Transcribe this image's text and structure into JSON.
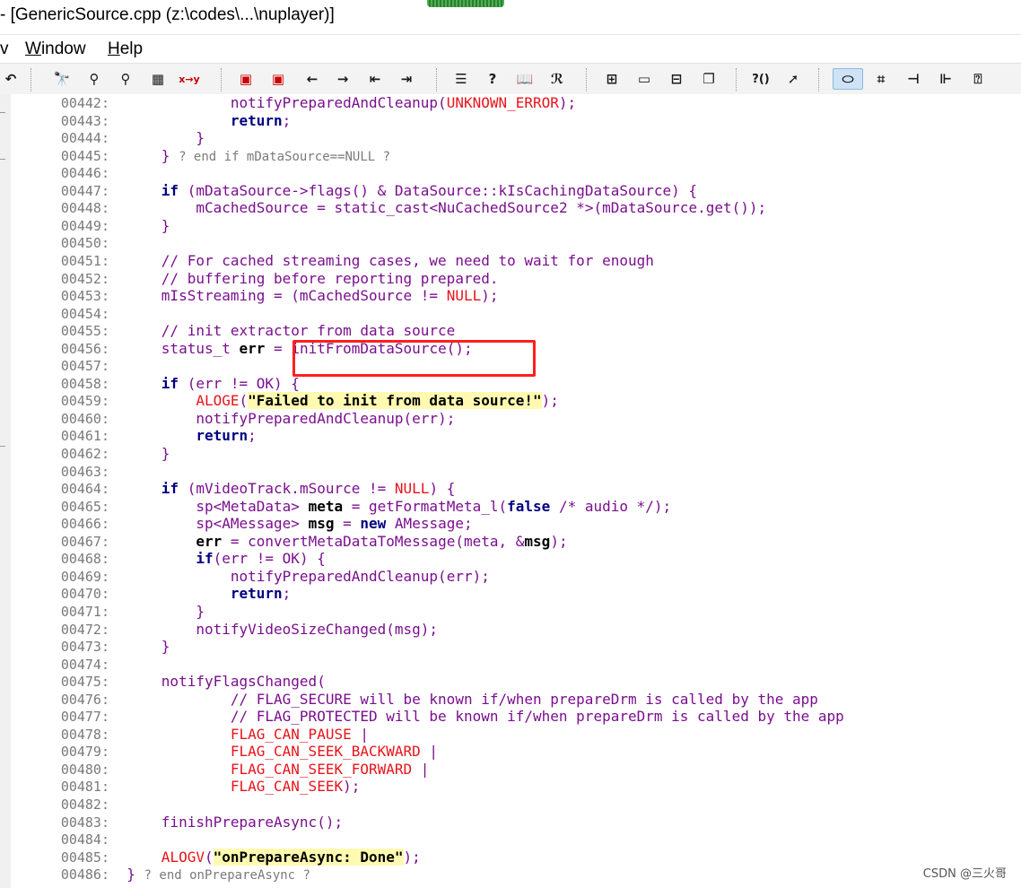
{
  "window": {
    "title": "- [GenericSource.cpp (z:\\codes\\...\\nuplayer)]"
  },
  "menu": {
    "partial_view": "v",
    "window_label": "Window",
    "window_underline": "W",
    "window_rest": "indow",
    "help_label": "Help",
    "help_underline": "H",
    "help_rest": "elp"
  },
  "toolbar": {
    "icons": [
      "undo-icon",
      "find-icon",
      "find-next-icon",
      "find-prev-icon",
      "find-in-files-icon",
      "replace-icon",
      "bookmark-prev-icon",
      "bookmark-next-icon",
      "back-icon",
      "forward-icon",
      "indent-left-icon",
      "indent-right-icon",
      "symbol-window-icon",
      "project-icon",
      "book-icon",
      "relation-icon",
      "tile-icon",
      "window-icon",
      "window-split-icon",
      "cascade-icon",
      "context-help-icon",
      "pointer-help-icon",
      "highlight-icon",
      "layout-icon",
      "tree-icon",
      "branch-icon",
      "info-icon"
    ],
    "xy_label": "x→y",
    "help_label": "?()"
  },
  "code": {
    "lines": [
      {
        "no": "00442:",
        "text": "            notifyPreparedAndCleanup(UNKNOWN_ERROR);"
      },
      {
        "no": "00443:",
        "text": "            return;"
      },
      {
        "no": "00444:",
        "text": "        }"
      },
      {
        "no": "00445:",
        "text": "    } ? end if mDataSource==NULL ?"
      },
      {
        "no": "00446:",
        "text": ""
      },
      {
        "no": "00447:",
        "text": "    if (mDataSource->flags() & DataSource::kIsCachingDataSource) {"
      },
      {
        "no": "00448:",
        "text": "        mCachedSource = static_cast<NuCachedSource2 *>(mDataSource.get());"
      },
      {
        "no": "00449:",
        "text": "    }"
      },
      {
        "no": "00450:",
        "text": ""
      },
      {
        "no": "00451:",
        "text": "    // For cached streaming cases, we need to wait for enough"
      },
      {
        "no": "00452:",
        "text": "    // buffering before reporting prepared."
      },
      {
        "no": "00453:",
        "text": "    mIsStreaming = (mCachedSource != NULL);"
      },
      {
        "no": "00454:",
        "text": ""
      },
      {
        "no": "00455:",
        "text": "    // init extractor from data source"
      },
      {
        "no": "00456:",
        "text": "    status_t err = initFromDataSource();"
      },
      {
        "no": "00457:",
        "text": ""
      },
      {
        "no": "00458:",
        "text": "    if (err != OK) {"
      },
      {
        "no": "00459:",
        "text": "        ALOGE(\"Failed to init from data source!\");"
      },
      {
        "no": "00460:",
        "text": "        notifyPreparedAndCleanup(err);"
      },
      {
        "no": "00461:",
        "text": "        return;"
      },
      {
        "no": "00462:",
        "text": "    }"
      },
      {
        "no": "00463:",
        "text": ""
      },
      {
        "no": "00464:",
        "text": "    if (mVideoTrack.mSource != NULL) {"
      },
      {
        "no": "00465:",
        "text": "        sp<MetaData> meta = getFormatMeta_l(false /* audio */);"
      },
      {
        "no": "00466:",
        "text": "        sp<AMessage> msg = new AMessage;"
      },
      {
        "no": "00467:",
        "text": "        err = convertMetaDataToMessage(meta, &msg);"
      },
      {
        "no": "00468:",
        "text": "        if(err != OK) {"
      },
      {
        "no": "00469:",
        "text": "            notifyPreparedAndCleanup(err);"
      },
      {
        "no": "00470:",
        "text": "            return;"
      },
      {
        "no": "00471:",
        "text": "        }"
      },
      {
        "no": "00472:",
        "text": "        notifyVideoSizeChanged(msg);"
      },
      {
        "no": "00473:",
        "text": "    }"
      },
      {
        "no": "00474:",
        "text": ""
      },
      {
        "no": "00475:",
        "text": "    notifyFlagsChanged("
      },
      {
        "no": "00476:",
        "text": "            // FLAG_SECURE will be known if/when prepareDrm is called by the app"
      },
      {
        "no": "00477:",
        "text": "            // FLAG_PROTECTED will be known if/when prepareDrm is called by the app"
      },
      {
        "no": "00478:",
        "text": "            FLAG_CAN_PAUSE |"
      },
      {
        "no": "00479:",
        "text": "            FLAG_CAN_SEEK_BACKWARD |"
      },
      {
        "no": "00480:",
        "text": "            FLAG_CAN_SEEK_FORWARD |"
      },
      {
        "no": "00481:",
        "text": "            FLAG_CAN_SEEK);"
      },
      {
        "no": "00482:",
        "text": ""
      },
      {
        "no": "00483:",
        "text": "    finishPrepareAsync();"
      },
      {
        "no": "00484:",
        "text": ""
      },
      {
        "no": "00485:",
        "text": "    ALOGV(\"onPrepareAsync: Done\");"
      },
      {
        "no": "00486:",
        "text": "} ? end onPrepareAsync ?"
      }
    ]
  },
  "watermark": "CSDN @三火哥",
  "colors": {
    "keyword": "#000080",
    "identifier": "#7a0f8e",
    "macro": "#e8141b",
    "string_bg": "#fffab0",
    "highlight_box": "#ff1f1f"
  }
}
